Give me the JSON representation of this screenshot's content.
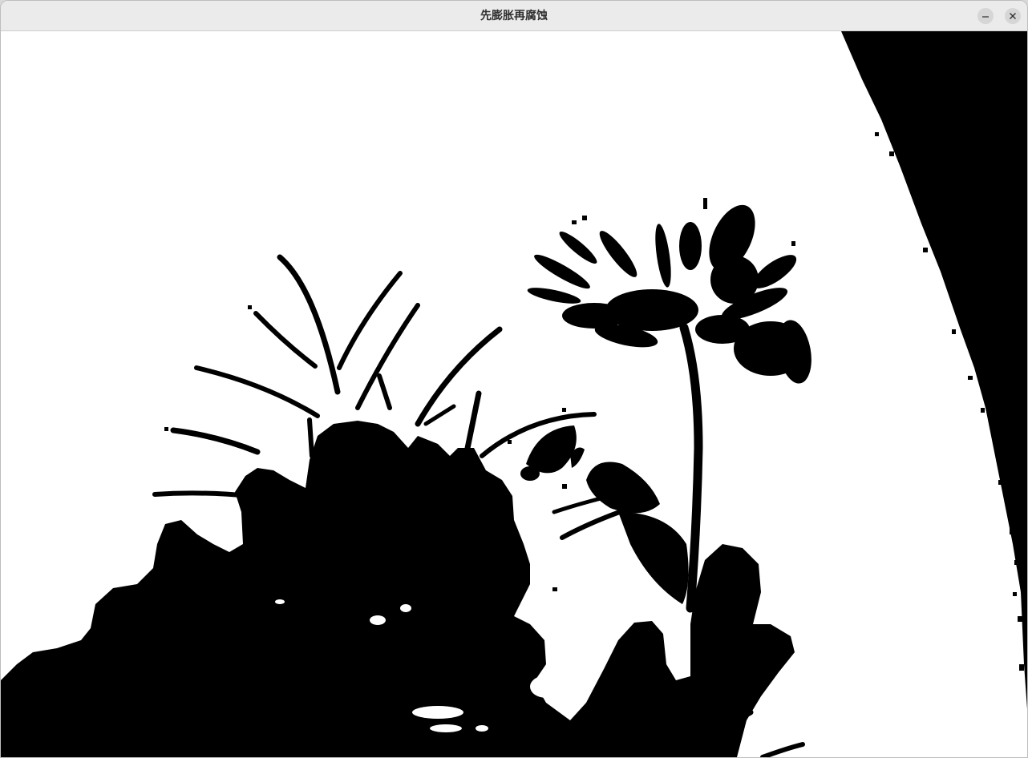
{
  "window": {
    "title": "先膨胀再腐蚀"
  },
  "controls": {
    "minimize_icon": "minimize-icon",
    "close_icon": "close-icon"
  },
  "image": {
    "description_type": "binary-morphology-result",
    "foreground_color": "#000000",
    "background_color": "#ffffff"
  },
  "colors": {
    "titlebar": "#ebebeb",
    "title_text": "#2e2e2e",
    "button_bg": "#d6d6d6"
  }
}
